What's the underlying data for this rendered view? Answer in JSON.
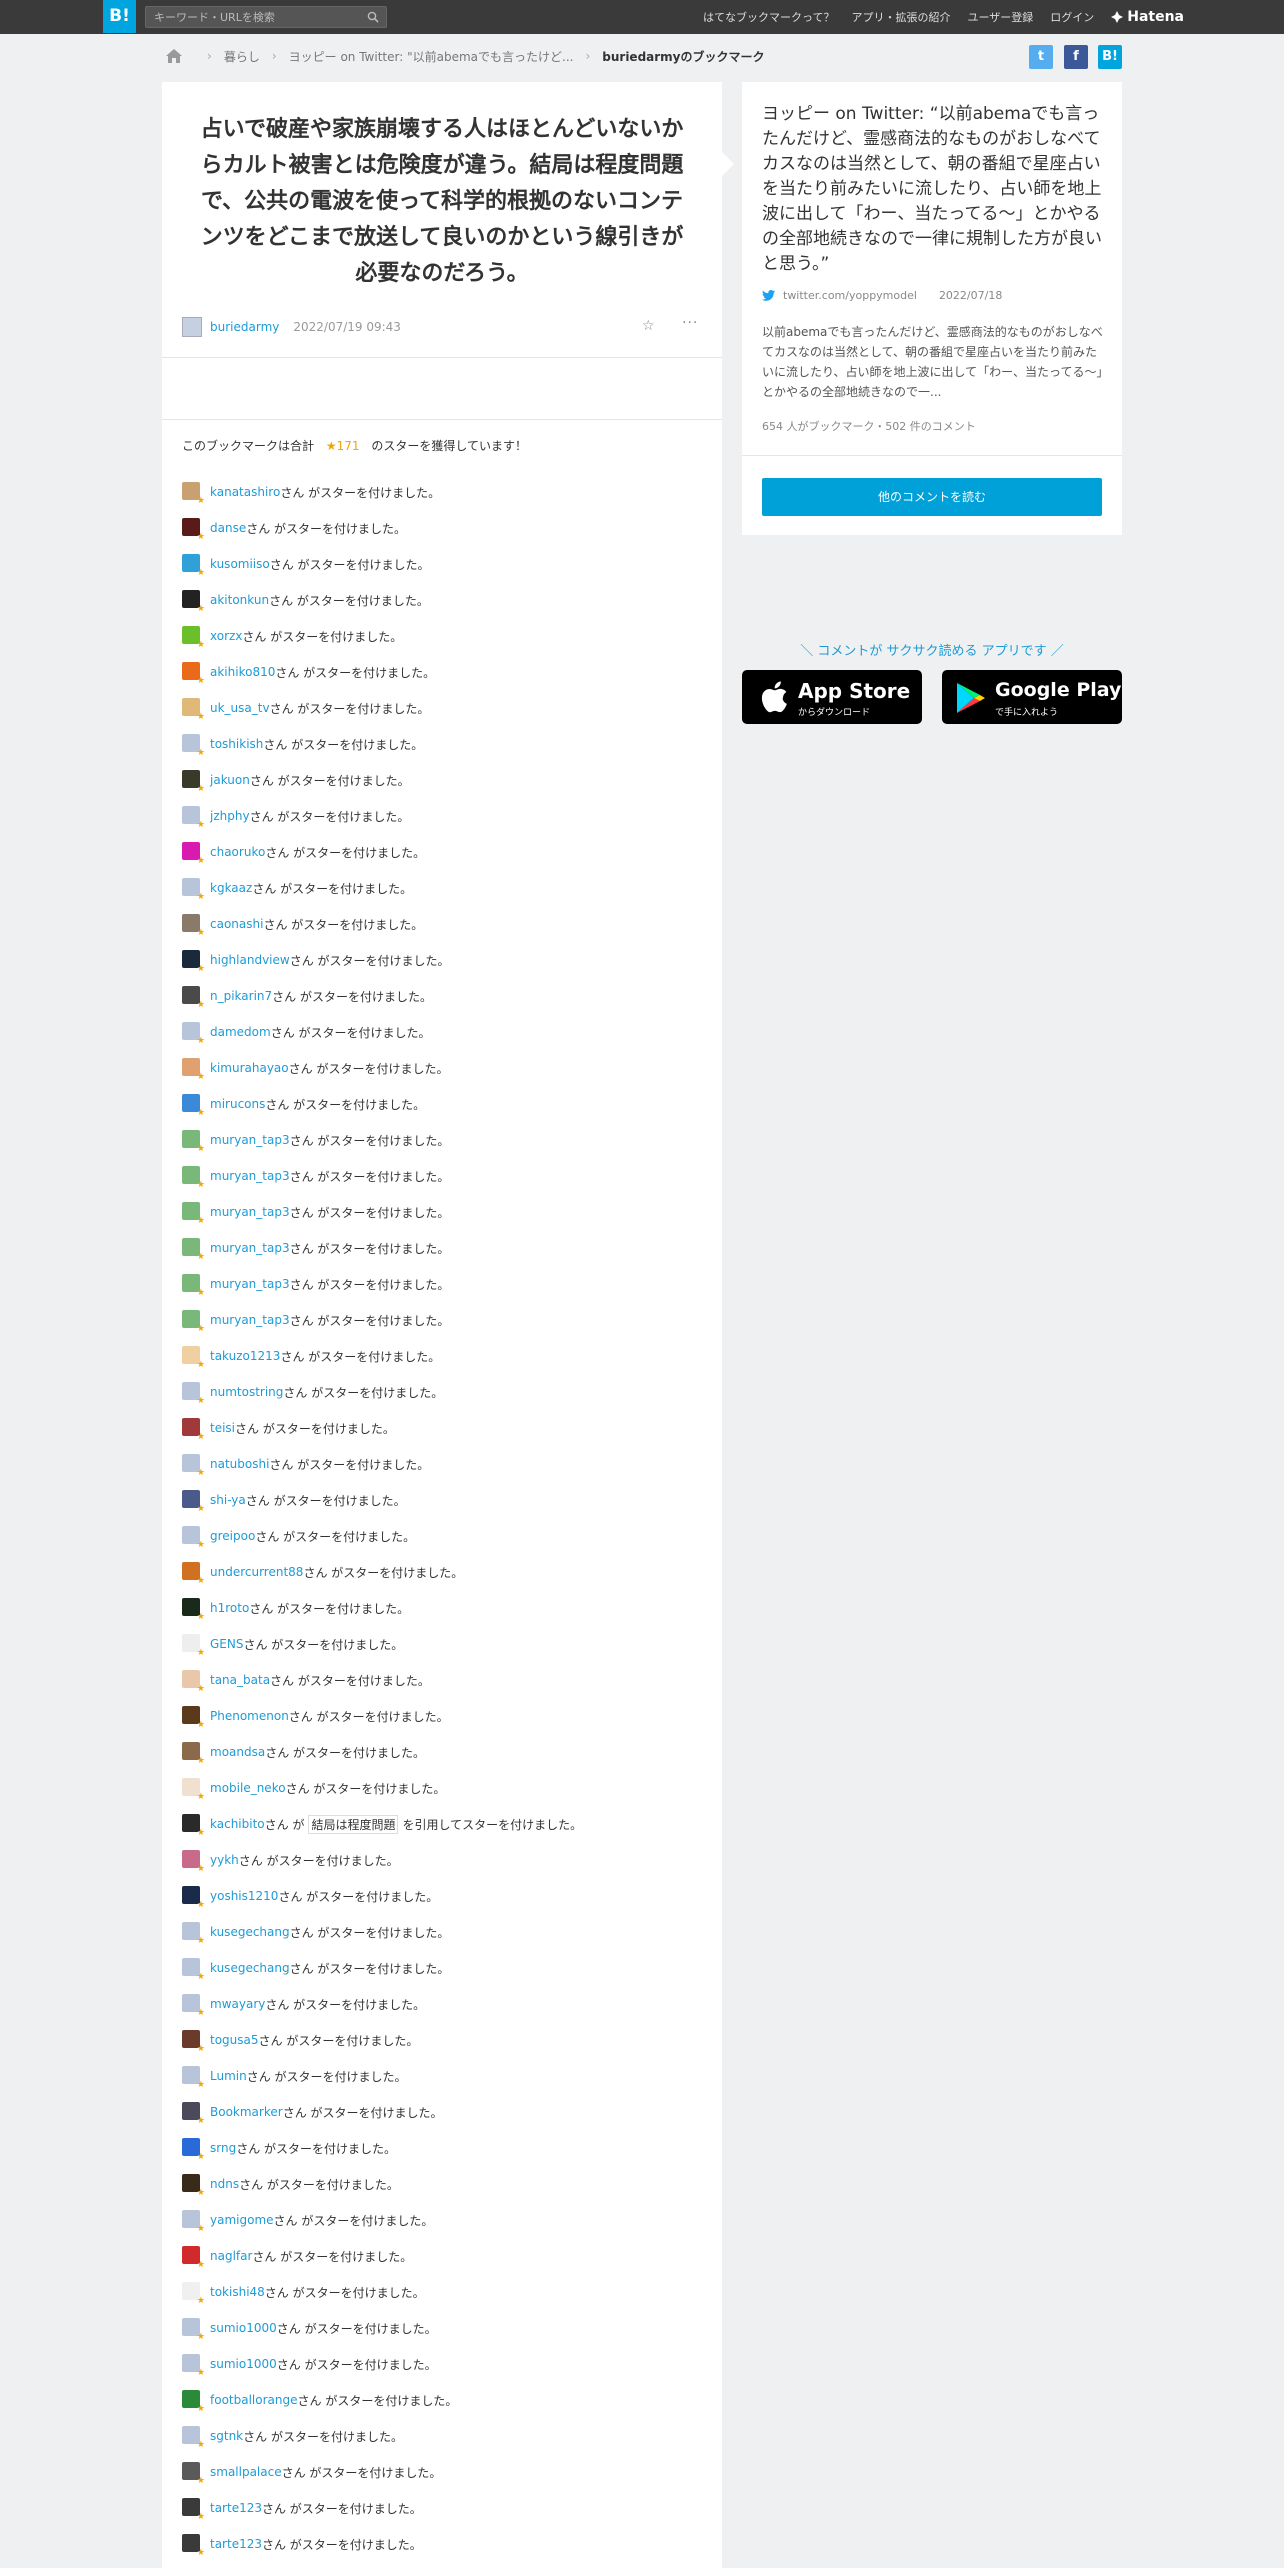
{
  "header": {
    "logo": "B!",
    "search_placeholder": "キーワード・URLを検索",
    "nav": [
      "はてなブックマークって？",
      "アプリ・拡張の紹介",
      "ユーザー登録",
      "ログイン"
    ],
    "brand": "Hatena"
  },
  "breadcrumb": {
    "items": [
      "暮らし",
      "ヨッピー on Twitter: \"以前abemaでも言ったけど..."
    ],
    "current": "buriedarmyのブックマーク"
  },
  "social": {
    "twitter": "t",
    "facebook": "f",
    "hatena": "B!"
  },
  "bookmark": {
    "comment": "占いで破産や家族崩壊する人はほとんどいないからカルト被害とは危険度が違う。結局は程度問題で、公共の電波を使って科学的根拠のないコンテンツをどこまで放送して良いのかという線引きが必要なのだろう。",
    "user": "buriedarmy",
    "date": "2022/07/19 09:43",
    "more": "···"
  },
  "stars": {
    "summary_prefix": "このブックマークは合計",
    "count": "★171",
    "summary_suffix": "のスターを獲得しています！",
    "row_suffix": "さん がスターを付けました。",
    "quote_prefix": "さん が",
    "quote_suffix": "を引用してスターを付けました。",
    "rows": [
      {
        "name": "kanatashiro",
        "color": "#c9a070"
      },
      {
        "name": "danse",
        "color": "#5a1a1a"
      },
      {
        "name": "kusomiiso",
        "color": "#2fa0d8"
      },
      {
        "name": "akitonkun",
        "color": "#222222"
      },
      {
        "name": "xorzx",
        "color": "#6bbf2a"
      },
      {
        "name": "akihiko810",
        "color": "#e86a1a"
      },
      {
        "name": "uk_usa_tv",
        "color": "#e0b878"
      },
      {
        "name": "toshikish",
        "color": "#b7c4d9"
      },
      {
        "name": "jakuon",
        "color": "#3a3a2a"
      },
      {
        "name": "jzhphy",
        "color": "#b7c4d9"
      },
      {
        "name": "chaoruko",
        "color": "#d81ab0"
      },
      {
        "name": "kgkaaz",
        "color": "#b7c4d9"
      },
      {
        "name": "caonashi",
        "color": "#8a7a6a"
      },
      {
        "name": "highlandview",
        "color": "#1a2a3a"
      },
      {
        "name": "n_pikarin7",
        "color": "#4a4a4a"
      },
      {
        "name": "damedom",
        "color": "#b7c4d9"
      },
      {
        "name": "kimurahayao",
        "color": "#e0a070"
      },
      {
        "name": "mirucons",
        "color": "#3a8ad8"
      },
      {
        "name": "muryan_tap3",
        "color": "#7ab87a"
      },
      {
        "name": "muryan_tap3",
        "color": "#7ab87a"
      },
      {
        "name": "muryan_tap3",
        "color": "#7ab87a"
      },
      {
        "name": "muryan_tap3",
        "color": "#7ab87a"
      },
      {
        "name": "muryan_tap3",
        "color": "#7ab87a"
      },
      {
        "name": "muryan_tap3",
        "color": "#7ab87a"
      },
      {
        "name": "takuzo1213",
        "color": "#f0d0a0"
      },
      {
        "name": "numtostring",
        "color": "#b7c4d9"
      },
      {
        "name": "teisi",
        "color": "#a03a3a"
      },
      {
        "name": "natuboshi",
        "color": "#b7c4d9"
      },
      {
        "name": "shi-ya",
        "color": "#4a5a8a"
      },
      {
        "name": "greipoo",
        "color": "#b7c4d9"
      },
      {
        "name": "undercurrent88",
        "color": "#d07020"
      },
      {
        "name": "h1roto",
        "color": "#1a2a1a"
      },
      {
        "name": "GENS",
        "color": "#eeeeee"
      },
      {
        "name": "tana_bata",
        "color": "#e8c8a8"
      },
      {
        "name": "Phenomenon",
        "color": "#5a3a1a"
      },
      {
        "name": "moandsa",
        "color": "#8a6a4a"
      },
      {
        "name": "mobile_neko",
        "color": "#f0e0d0"
      },
      {
        "name": "kachibito",
        "color": "#2a2a2a",
        "quote": "結局は程度問題"
      },
      {
        "name": "yykh",
        "color": "#c86a8a"
      },
      {
        "name": "yoshis1210",
        "color": "#1a2a4a"
      },
      {
        "name": "kusegechang",
        "color": "#b7c4d9"
      },
      {
        "name": "kusegechang",
        "color": "#b7c4d9"
      },
      {
        "name": "mwayary",
        "color": "#b7c4d9"
      },
      {
        "name": "togusa5",
        "color": "#6a3a2a"
      },
      {
        "name": "Lumin",
        "color": "#b7c4d9"
      },
      {
        "name": "Bookmarker",
        "color": "#4a4a5a"
      },
      {
        "name": "srng",
        "color": "#2a6ad8"
      },
      {
        "name": "ndns",
        "color": "#3a2a1a"
      },
      {
        "name": "yamigome",
        "color": "#b7c4d9"
      },
      {
        "name": "naglfar",
        "color": "#d02a2a"
      },
      {
        "name": "tokishi48",
        "color": "#f0f0f0"
      },
      {
        "name": "sumio1000",
        "color": "#b7c4d9"
      },
      {
        "name": "sumio1000",
        "color": "#b7c4d9"
      },
      {
        "name": "footballorange",
        "color": "#2a8a3a"
      },
      {
        "name": "sgtnk",
        "color": "#b7c4d9"
      },
      {
        "name": "smallpalace",
        "color": "#5a5a5a"
      },
      {
        "name": "tarte123",
        "color": "#3a3a3a"
      },
      {
        "name": "tarte123",
        "color": "#3a3a3a"
      }
    ]
  },
  "entry": {
    "title": "ヨッピー on Twitter: “以前abemaでも言ったんだけど、霊感商法的なものがおしなべてカスなのは当然として、朝の番組で星座占いを当たり前みたいに流したり、占い師を地上波に出して「わー、当たってる〜」とかやるの全部地続きなので一律に規制した方が良いと思う。”",
    "source": "twitter.com/yoppymodel",
    "date": "2022/07/18",
    "description": "以前abemaでも言ったんだけど、霊感商法的なものがおしなべてカスなのは当然として、朝の番組で星座占いを当たり前みたいに流したり、占い師を地上波に出して「わー、当たってる〜」とかやるの全部地続きなので一...",
    "stats": "654 人がブックマーク・502 件のコメント",
    "read_more": "他のコメントを読む"
  },
  "promo": {
    "text": "＼ コメントが サクサク読める アプリです ／",
    "appstore_big": "App Store",
    "appstore_small": "からダウンロード",
    "gplay_big": "Google Play",
    "gplay_small": "で手に入れよう"
  }
}
